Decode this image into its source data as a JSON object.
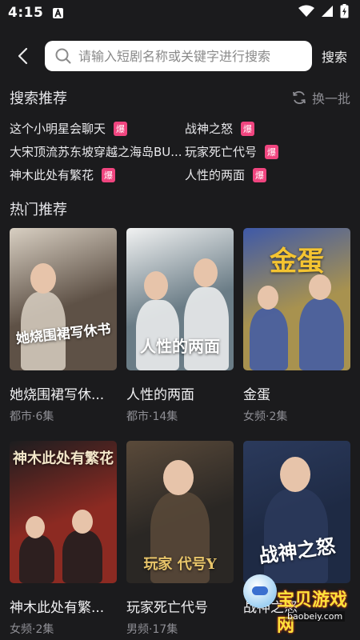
{
  "status": {
    "time": "4:15"
  },
  "search": {
    "placeholder": "请输入短剧名称或关键字进行搜索",
    "button_label": "搜索"
  },
  "suggest": {
    "title": "搜索推荐",
    "refresh_label": "换一批",
    "badge_label": "爆",
    "items": [
      {
        "text": "这个小明星会聊天",
        "hot": true
      },
      {
        "text": "战神之怒",
        "hot": true
      },
      {
        "text": "大宋顶流苏东坡穿越之海岛BU...",
        "hot": false
      },
      {
        "text": "玩家死亡代号",
        "hot": true
      },
      {
        "text": "神木此处有繁花",
        "hot": true
      },
      {
        "text": "人性的两面",
        "hot": true
      }
    ]
  },
  "hot": {
    "title": "热门推荐",
    "cards": [
      {
        "title": "她烧围裙写休...",
        "sub": "都市·6集",
        "poster_text": "她烧围裙写休书",
        "bg": "#5e5146",
        "accent": "#d8cfc2",
        "text_color": "#ffffff"
      },
      {
        "title": "人性的两面",
        "sub": "都市·14集",
        "poster_text": "人性的两面",
        "bg": "#6a7c86",
        "accent": "#f1f2f2",
        "text_color": "#ffffff"
      },
      {
        "title": "金蛋",
        "sub": "女频·2集",
        "poster_text": "金蛋",
        "bg": "#a8924f",
        "accent": "#3e59a8",
        "text_color": "#f4c431"
      },
      {
        "title": "神木此处有繁...",
        "sub": "女频·2集",
        "poster_text": "神木此处有繁花",
        "bg": "#8c2a22",
        "accent": "#1c1d1f",
        "text_color": "#f3e6c9"
      },
      {
        "title": "玩家死亡代号",
        "sub": "男频·17集",
        "poster_text": "玩家 代号Y",
        "bg": "#2a2724",
        "accent": "#5a4a3a",
        "text_color": "#e8c56a"
      },
      {
        "title": "战神之怒",
        "sub": "",
        "poster_text": "战神之怒",
        "bg": "#1e2a44",
        "accent": "#2b3a5c",
        "text_color": "#ffffff"
      }
    ]
  },
  "watermark": {
    "title": "宝贝游戏网",
    "url": "baobeiy.com"
  }
}
